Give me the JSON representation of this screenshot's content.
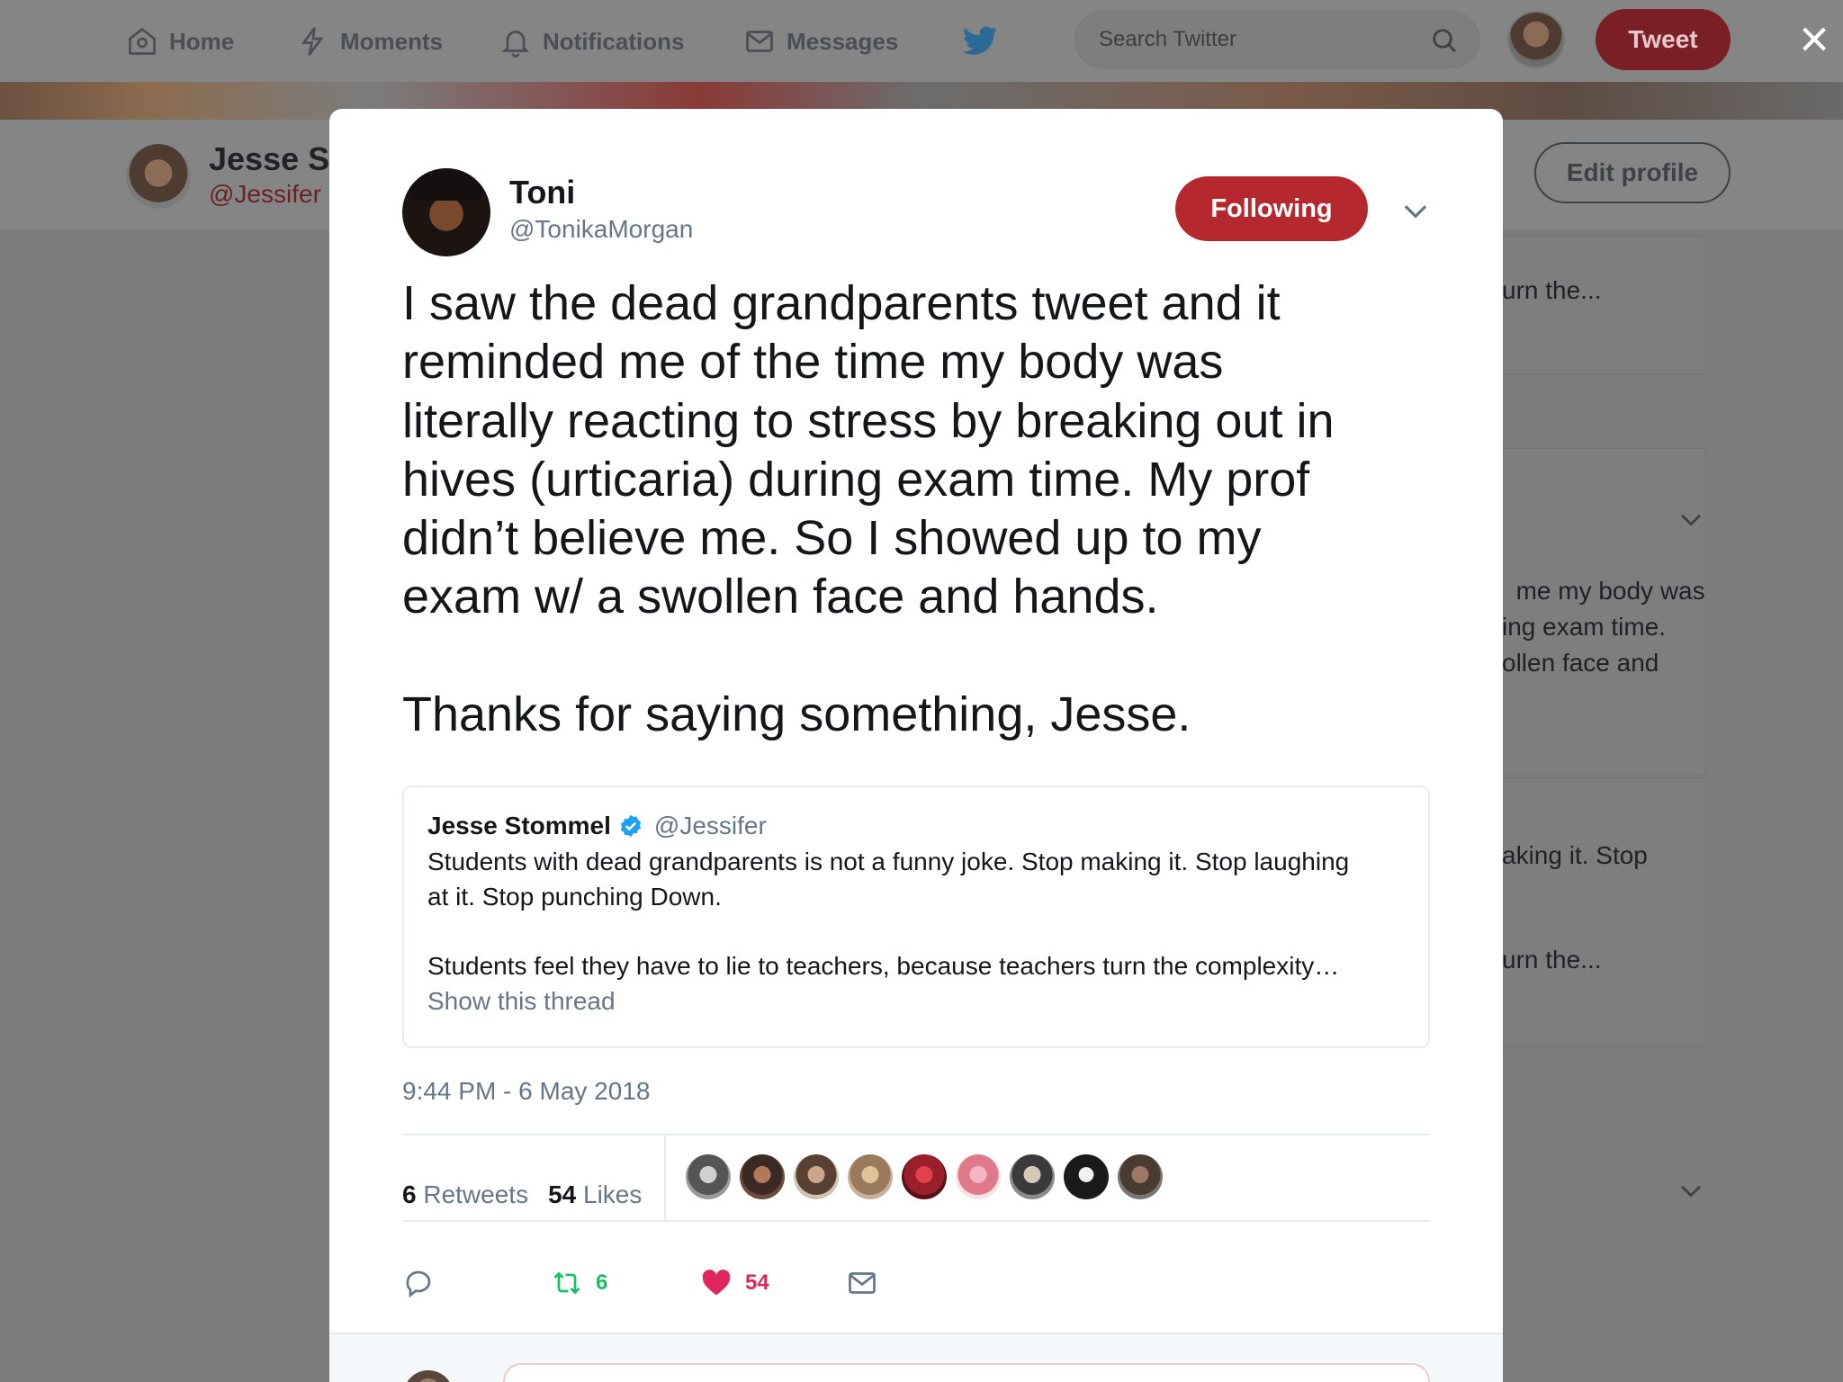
{
  "nav": {
    "home": "Home",
    "moments": "Moments",
    "notifications": "Notifications",
    "messages": "Messages",
    "search_placeholder": "Search Twitter",
    "tweet_button": "Tweet",
    "close": "×"
  },
  "profile": {
    "name": "Jesse S",
    "handle": "@Jessifer",
    "edit_button": "Edit profile"
  },
  "background_snippets": [
    "urn the...",
    "me my body was\ning exam time.\nollen face and",
    "aking it. Stop",
    "urn the..."
  ],
  "tweet": {
    "author_name": "Toni",
    "author_handle": "@TonikaMorgan",
    "follow_state": "Following",
    "text": "I saw the dead grandparents tweet and it\nreminded me of the time my body was\nliterally reacting to stress by breaking out in\nhives (urticaria) during exam time. My prof\ndidn’t believe me. So I showed up to my\nexam w/ a swollen face and hands.\n\nThanks for saying something, Jesse.",
    "quoted": {
      "name": "Jesse Stommel",
      "handle": "@Jessifer",
      "text": "Students with dead grandparents is not a funny joke. Stop making it. Stop laughing\nat it. Stop punching Down.\n\nStudents feel they have to lie to teachers, because teachers turn the complexity…",
      "link": "Show this thread"
    },
    "timestamp": "9:44 PM - 6 May 2018",
    "retweets_count": "6",
    "retweets_label": "Retweets",
    "likes_count": "54",
    "likes_label": "Likes",
    "action_retweet_count": "6",
    "action_like_count": "54"
  },
  "colors": {
    "accent": "#b5282d",
    "retweet_green": "#17bf63",
    "like_red": "#e0245e",
    "muted": "#657786",
    "verified_blue": "#1da1f2"
  },
  "icons": [
    "home-icon",
    "moments-icon",
    "notifications-icon",
    "messages-icon",
    "twitter-bird-icon",
    "search-icon",
    "close-icon",
    "chevron-down-icon",
    "verified-icon",
    "reply-icon",
    "retweet-icon",
    "heart-icon",
    "envelope-icon"
  ]
}
